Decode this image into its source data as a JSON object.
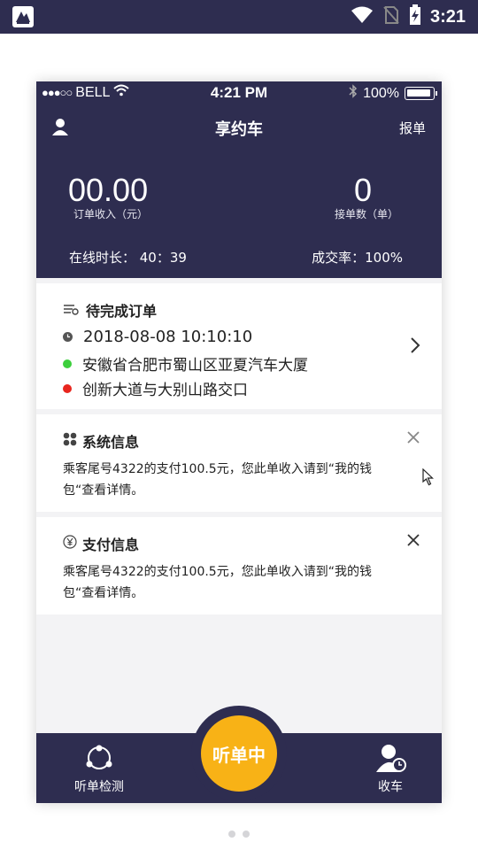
{
  "android_status": {
    "time": "3:21"
  },
  "ios_status": {
    "carrier": "BELL",
    "time": "4:21 PM",
    "battery": "100%"
  },
  "nav": {
    "title": "享约车",
    "report": "报单"
  },
  "stats": {
    "income_value": "00.00",
    "income_label": "订单收入（元）",
    "orders_value": "0",
    "orders_label": "接单数（单）",
    "online_text": "在线时长：  40：39",
    "rate_text": "成交率：100%"
  },
  "pending_order": {
    "title": "待完成订单",
    "time": "2018-08-08   10:10:10",
    "origin": "安徽省合肥市蜀山区亚夏汽车大厦",
    "destination": "创新大道与大别山路交口"
  },
  "messages": [
    {
      "title": "系统信息",
      "body": "乘客尾号4322的支付100.5元，您此单收入请到“我的钱包“查看详情。"
    },
    {
      "title": "支付信息",
      "body": "乘客尾号4322的支付100.5元，您此单收入请到“我的钱包“查看详情。"
    }
  ],
  "tabbar": {
    "left": "听单检测",
    "center": "听单中",
    "right": "收车"
  },
  "colors": {
    "header": "#2e2d50",
    "accent": "#f8b216",
    "origin": "#3ccf3c",
    "destination": "#e8261e"
  }
}
